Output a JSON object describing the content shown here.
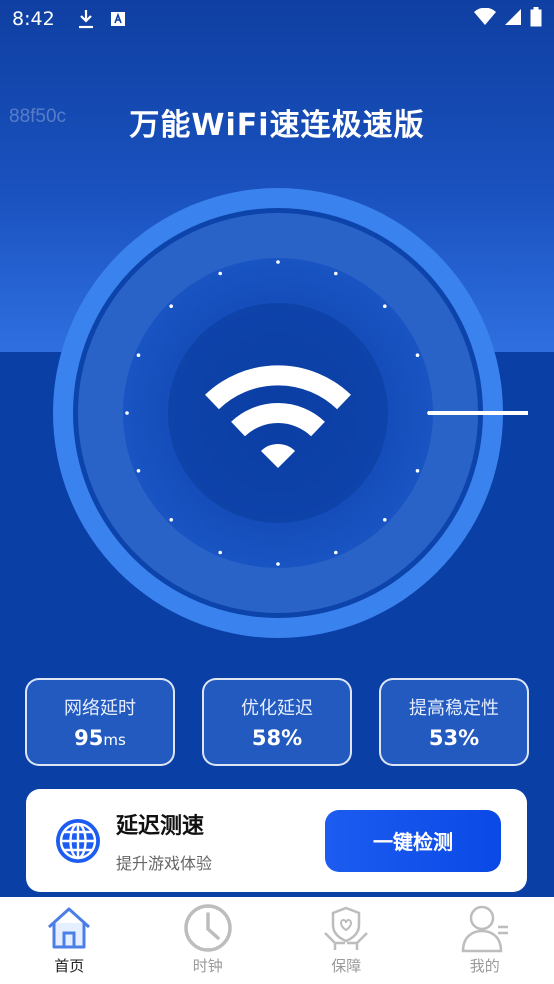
{
  "status_bar": {
    "time": "8:42"
  },
  "header": {
    "hex_label": "88f50c",
    "title": "万能WiFi速连极速版"
  },
  "stats": [
    {
      "label": "网络延时",
      "value": "95",
      "unit": "ms"
    },
    {
      "label": "优化延迟",
      "value": "58%",
      "unit": ""
    },
    {
      "label": "提高稳定性",
      "value": "53%",
      "unit": ""
    }
  ],
  "promo": {
    "title": "延迟测速",
    "subtitle": "提升游戏体验",
    "button_label": "一键检测"
  },
  "tabs": [
    {
      "label": "首页",
      "icon": "home-icon",
      "active": true
    },
    {
      "label": "时钟",
      "icon": "clock-icon",
      "active": false
    },
    {
      "label": "保障",
      "icon": "shield-hands-icon",
      "active": false
    },
    {
      "label": "我的",
      "icon": "profile-icon",
      "active": false
    }
  ],
  "colors": {
    "primary": "#0a40a6",
    "accent": "#1d5cf0",
    "ring": "#3a82ee"
  }
}
